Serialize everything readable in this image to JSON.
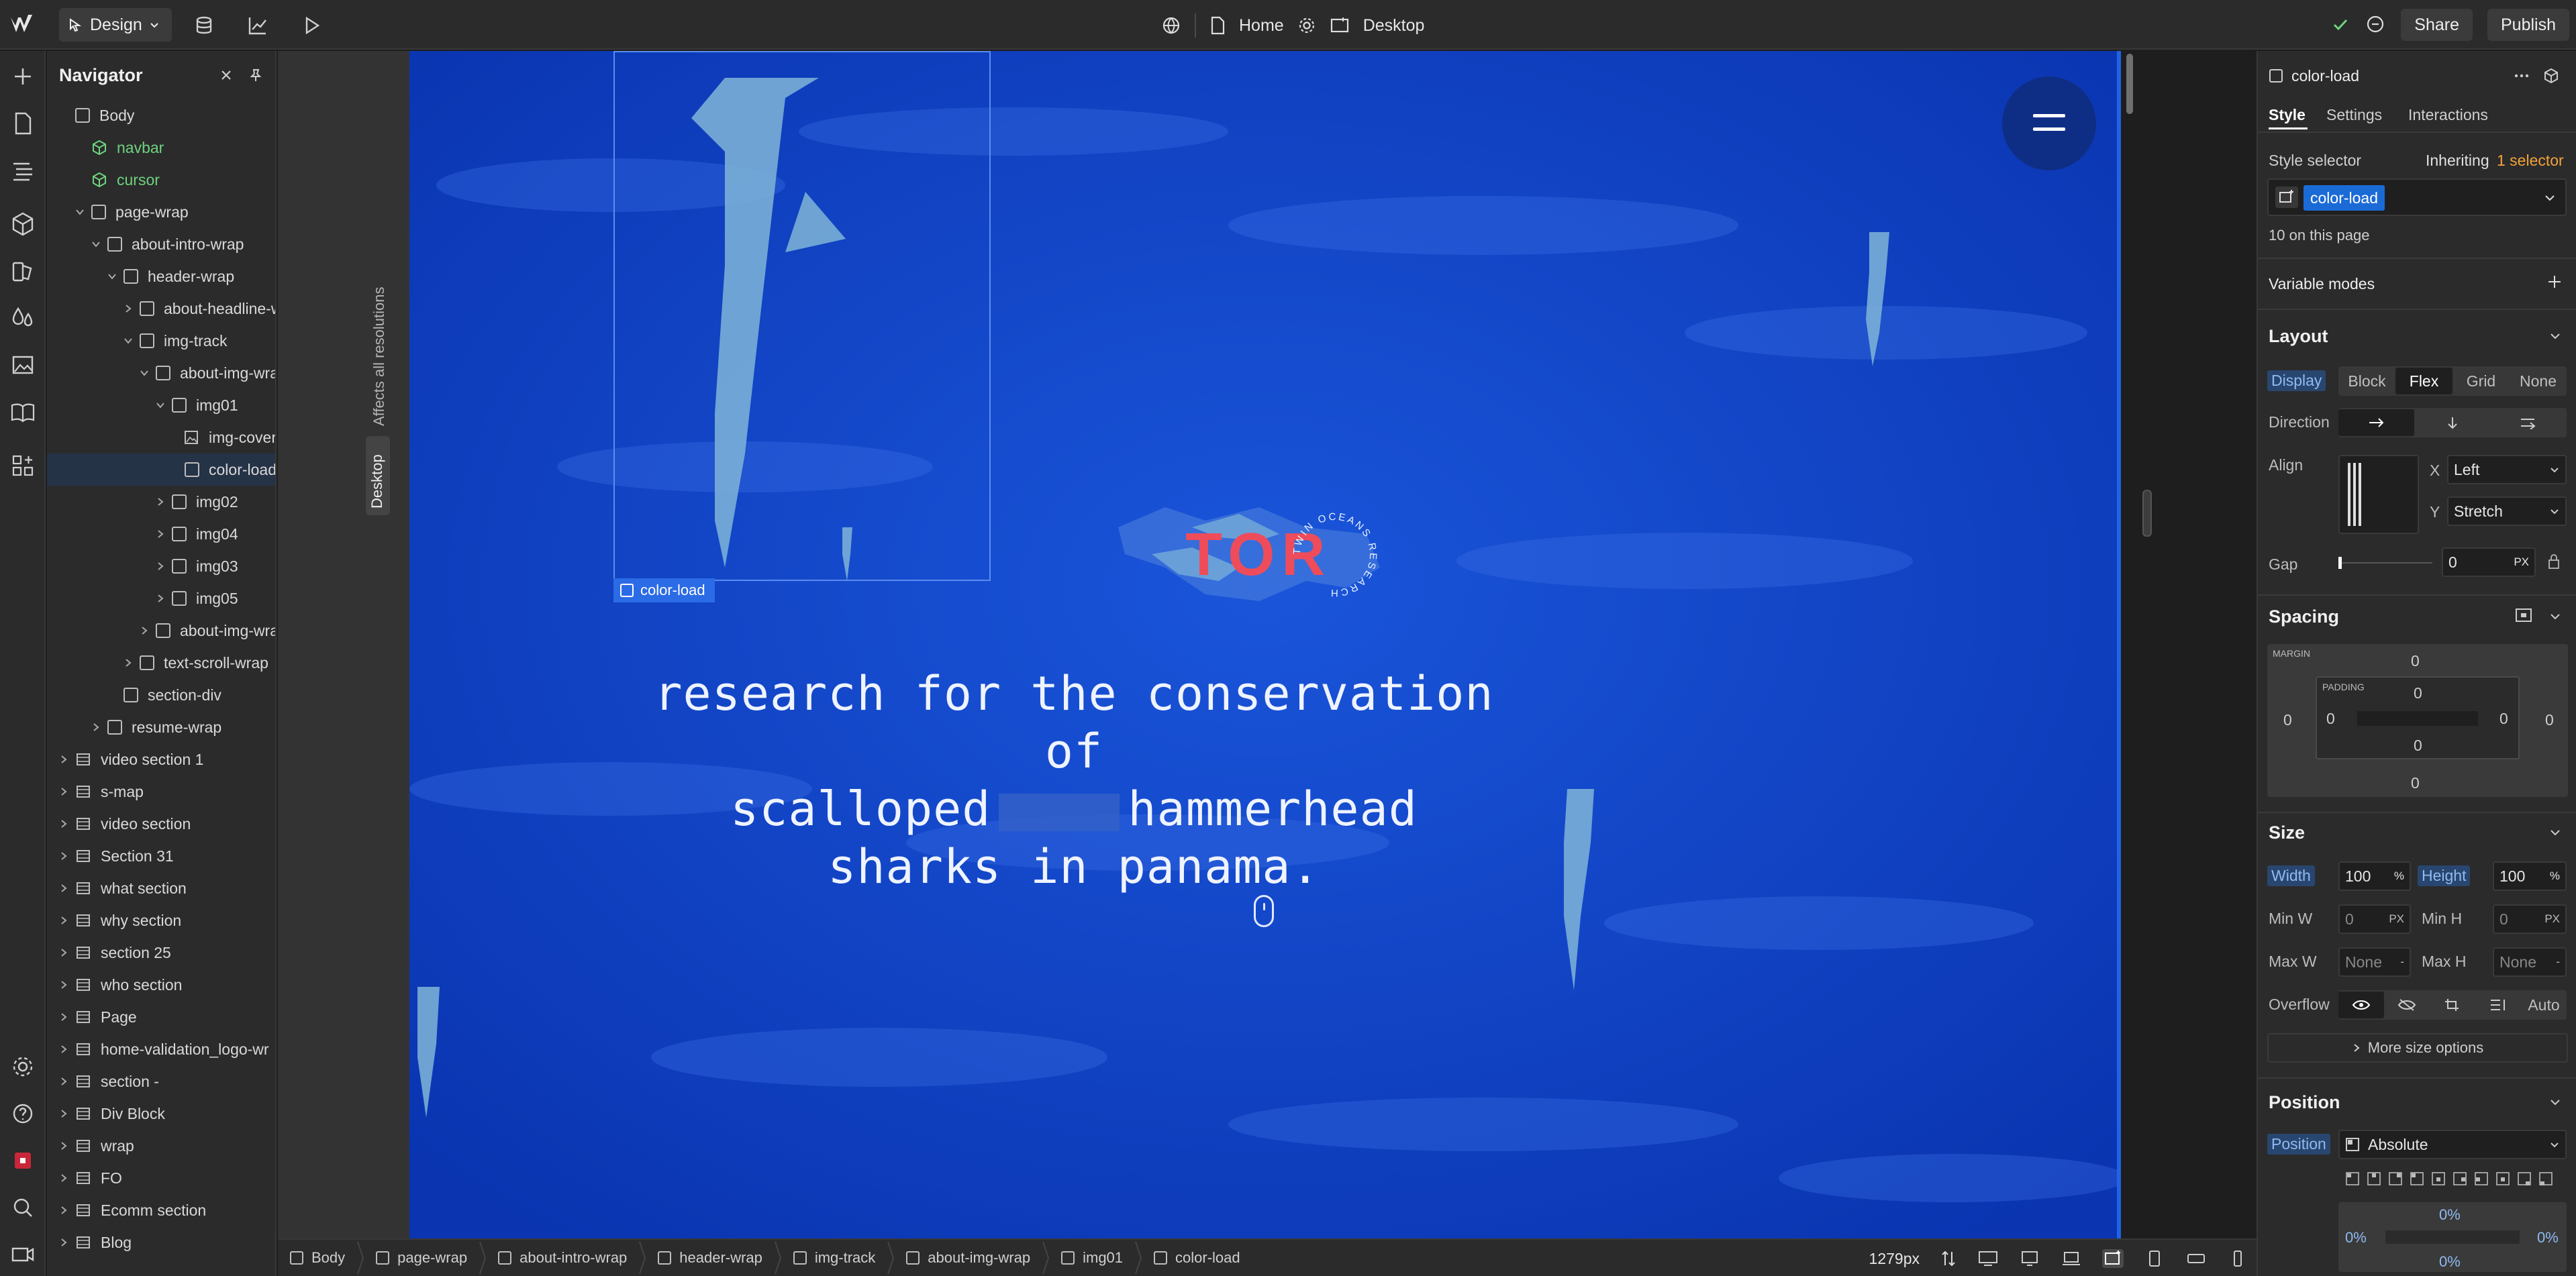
{
  "topbar": {
    "mode_label": "Design",
    "page_label": "Home",
    "breakpoint_label": "Desktop",
    "share_label": "Share",
    "publish_label": "Publish"
  },
  "navigator": {
    "title": "Navigator",
    "items": [
      {
        "label": "Body"
      },
      {
        "label": "navbar"
      },
      {
        "label": "cursor"
      },
      {
        "label": "page-wrap"
      },
      {
        "label": "about-intro-wrap"
      },
      {
        "label": "header-wrap"
      },
      {
        "label": "about-headline-w"
      },
      {
        "label": "img-track"
      },
      {
        "label": "about-img-wrap"
      },
      {
        "label": "img01"
      },
      {
        "label": "img-cover"
      },
      {
        "label": "color-load"
      },
      {
        "label": "img02"
      },
      {
        "label": "img04"
      },
      {
        "label": "img03"
      },
      {
        "label": "img05"
      },
      {
        "label": "about-img-wrap"
      },
      {
        "label": "text-scroll-wrap"
      },
      {
        "label": "section-div"
      },
      {
        "label": "resume-wrap"
      },
      {
        "label": "video section 1"
      },
      {
        "label": "s-map"
      },
      {
        "label": "video section"
      },
      {
        "label": "Section 31"
      },
      {
        "label": "what section"
      },
      {
        "label": "why section"
      },
      {
        "label": "section 25"
      },
      {
        "label": "who section"
      },
      {
        "label": "Page"
      },
      {
        "label": "home-validation_logo-wr"
      },
      {
        "label": "section -"
      },
      {
        "label": "Div Block"
      },
      {
        "label": "wrap"
      },
      {
        "label": "FO"
      },
      {
        "label": "Ecomm section"
      },
      {
        "label": "Blog"
      }
    ]
  },
  "strip": {
    "affects_label": "Affects all resolutions",
    "desktop_label": "Desktop"
  },
  "canvas": {
    "selected_tag": "color-load",
    "hero_line1": "research for the conservation of",
    "hero_line2a": "scalloped",
    "hero_line2b": "hammerhead",
    "hero_line3": "sharks in panama.",
    "logo_text": "TOR",
    "logo_ring_text": "TWIN OCEANS RESEARCH"
  },
  "breadcrumb": {
    "items": [
      "Body",
      "page-wrap",
      "about-intro-wrap",
      "header-wrap",
      "img-track",
      "about-img-wrap",
      "img01",
      "color-load"
    ],
    "width_readout": "1279px"
  },
  "panel": {
    "element_name": "color-load",
    "tabs": [
      "Style",
      "Settings",
      "Interactions"
    ],
    "style_selector_label": "Style selector",
    "inheriting_label": "Inheriting",
    "inheriting_count": "1 selector",
    "selector_chip": "color-load",
    "on_page_count": "10 on this page",
    "variable_modes": "Variable modes",
    "layout": {
      "title": "Layout",
      "display_label": "Display",
      "display_options": [
        "Block",
        "Flex",
        "Grid",
        "None"
      ],
      "direction_label": "Direction",
      "align_label": "Align",
      "x_label": "X",
      "x_value": "Left",
      "y_label": "Y",
      "y_value": "Stretch",
      "gap_label": "Gap",
      "gap_value": "0",
      "gap_unit": "PX"
    },
    "spacing": {
      "title": "Spacing",
      "margin_label": "MARGIN",
      "padding_label": "PADDING",
      "margin": {
        "top": "0",
        "right": "0",
        "bottom": "0",
        "left": "0"
      },
      "padding": {
        "top": "0",
        "right": "0",
        "bottom": "0",
        "left": "0"
      }
    },
    "size": {
      "title": "Size",
      "width_label": "Width",
      "width_value": "100",
      "width_unit": "%",
      "height_label": "Height",
      "height_value": "100",
      "height_unit": "%",
      "minw_label": "Min W",
      "minw_value": "0",
      "minw_unit": "PX",
      "minh_label": "Min H",
      "minh_value": "0",
      "minh_unit": "PX",
      "maxw_label": "Max W",
      "maxw_value": "None",
      "maxw_unit": "-",
      "maxh_label": "Max H",
      "maxh_value": "None",
      "maxh_unit": "-",
      "overflow_label": "Overflow",
      "overflow_auto": "Auto",
      "more_options": "More size options"
    },
    "position": {
      "title": "Position",
      "position_label": "Position",
      "position_value": "Absolute",
      "offset_top": "0%",
      "offset_left": "0%",
      "offset_right": "0%",
      "offset_bottom": "0%"
    }
  },
  "colors": {
    "canvas_blue": "#0c3fc6",
    "selection": "#2b6be6",
    "green_component": "#6ed37f",
    "logo_red": "#ee4c5a",
    "panel_bg": "#2b2b2b"
  },
  "icons": [
    "webflow-logo-icon",
    "cms-icon",
    "analytics-icon",
    "preview-icon",
    "globe-icon",
    "page-icon",
    "settings-icon",
    "breakpoint-icon",
    "check-icon",
    "comment-icon",
    "add-icon",
    "pages-icon",
    "navigator-icon",
    "components-icon",
    "variables-icon",
    "styles-icon",
    "assets-icon",
    "help-icon",
    "apps-icon",
    "close-icon",
    "pin-icon",
    "more-icon",
    "3d-icon"
  ]
}
